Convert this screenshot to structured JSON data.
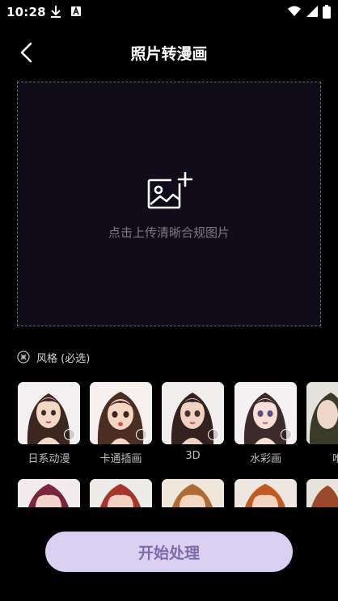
{
  "status_bar": {
    "time": "10:28"
  },
  "header": {
    "title": "照片转漫画"
  },
  "upload": {
    "hint": "点击上传清晰合规图片"
  },
  "style_section": {
    "label": "风格 (必选)"
  },
  "styles": [
    {
      "label": "日系动漫"
    },
    {
      "label": "卡通插画"
    },
    {
      "label": "3D"
    },
    {
      "label": "水彩画"
    },
    {
      "label": "唯"
    }
  ],
  "start_button": {
    "label": "开始处理"
  },
  "colors": {
    "background": "#000000",
    "upload_bg": "#100c19",
    "button_bg": "#d9d0f2",
    "button_text": "#7f6aa8"
  }
}
